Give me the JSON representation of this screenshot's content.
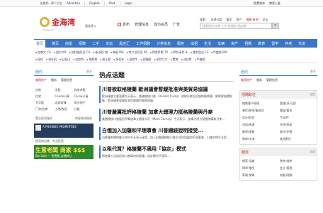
{
  "topbar": {
    "site": "北美第一華人平台",
    "links": [
      "Advertise",
      "English",
      "Post",
      "Login"
    ],
    "right": [
      "免費發布",
      "商家入駐"
    ]
  },
  "header": {
    "logo": "金海湾",
    "logo_sub": "Jinhay.com",
    "city": "请选择 ▾",
    "links": [
      "发布",
      "管理信息",
      "成为会员",
      "广告"
    ],
    "right_links": [
      "搜索:",
      "本地分类",
      "黄页",
      "房产",
      "博客·新闻",
      "论坛"
    ],
    "search_placeholder": "搜索纽约·房源·工作·找服务·找店铺"
  },
  "nav": {
    "items": [
      "首页",
      "黄页",
      "房屋",
      "招聘",
      "二手",
      "论坛",
      "黑店汇",
      "工作招聘",
      "分类信息",
      "服务",
      "出租",
      "生活",
      "车辆",
      "房产",
      "招聘",
      "教育",
      "留学",
      "养老",
      "交友"
    ]
  },
  "sub_nav": {
    "row1": [
      "加拿大 CA",
      "纽约 NY",
      "加利福尼亚 CA",
      "新泽西 NJ",
      "麻省 MA",
      "宾夕法尼亚 PA",
      "得克萨斯 TX",
      "伊利诺伊 IL",
      "佛罗里达 FL",
      "华盛顿 WA",
      "弗吉尼亚 VA",
      "亚利桑那 AZ",
      "俄亥俄 OH"
    ],
    "row2": [
      "纽约",
      "洛杉矶",
      "旧金山",
      "芝加哥",
      "休斯顿",
      "波士顿",
      "多伦多",
      "温哥华",
      "西雅图",
      "亚特兰大",
      "费城",
      "达拉斯",
      "华盛顿",
      "圣地亚哥",
      "迈阿密",
      "凤凰城"
    ]
  },
  "left": {
    "title": "纽约",
    "more": "更多",
    "tabs": [
      "美国房产",
      "服务",
      "管理信息"
    ],
    "grid": [
      "出售",
      "出租",
      "找房求租",
      "住宅",
      "Condo公寓",
      "Co-op公寓",
      "写字楼",
      "店面商铺",
      "商业地产",
      "厂房/仓库",
      "土地/农场",
      "分租"
    ],
    "sub_a": "置业投资服务",
    "sub_b": "房屋装修服务",
    "ad_dark_text": "A PHOENIX PROPERTIES",
    "ad_caption": "投资房出售 · 专业投资",
    "ad_green_big": "生意老闆 商家 $$$",
    "ad_green_small": "Biz Sale — 免费看 店铺转让"
  },
  "middle": {
    "heading": "热点话题",
    "stories": [
      {
        "title": "川普欲取格陵蘭  歐洲議會暫緩批准與美貿易協議",
        "body": "歐洲議會主要黨團今天表示，美國總統川普（Donald Trump）欲取丹麥自治領地格陵蘭，威脅實施關稅後，歐洲議會暫緩批准與美國的貿易協議..."
      },
      {
        "title": "川普嚴厲批評格陵蘭  加拿大總理力挺格陵蘭與丹麥",
        "body": "美國總統川普猛烈抨擊加拿大總理卡尼（Mark Carney）今天表示，加拿大將力挺格陵蘭和丹麥..."
      },
      {
        "title": "白俄加入加薩和平理事會  川普總統說明接受...",
        "body": "白俄羅斯總統魯卡申科今天表示接受...加入由美國總統川普主導的加薩和平理事會，川普的和平方案..."
      },
      {
        "title": "以租代買？格陵蘭不適用「協定」模式",
        "body": "格陵蘭人告訴記者川普政府的提議，協定模式不適用..."
      }
    ]
  },
  "right": {
    "title": "纽约",
    "more": "更多",
    "tabs": [
      "美国房产",
      "服务",
      "管理信息"
    ],
    "box1_title": "招聘职位",
    "box1_more": "全部",
    "box1_items": [
      "销售客户经理",
      "管理(办公室)",
      "餐饮/厨师/服务员",
      "美容/美发",
      "会计/财务",
      "IT/软件",
      "司机/快递",
      "仓库/物流",
      "教师/家教",
      "医疗/护理",
      "装修/水电",
      "其他职位"
    ],
    "box2_title": "服务",
    "box2_more": "全部",
    "box2_items": [
      "搬家·运输",
      "装修·维修",
      "律师·移民",
      "会计·报税",
      "家政·保姆",
      "电脑·网络"
    ]
  }
}
